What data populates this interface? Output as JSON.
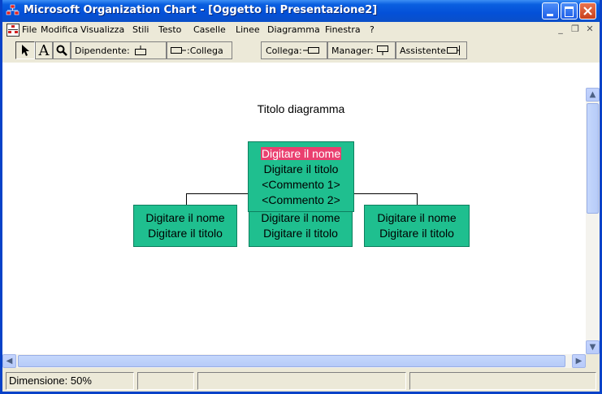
{
  "window": {
    "title": "Microsoft Organization Chart - [Oggetto in Presentazione2]",
    "accent_color": "#0a5fe0"
  },
  "menubar": {
    "items": [
      "File",
      "Modifica",
      "Visualizza",
      "Stili",
      "Testo",
      "Caselle",
      "Linee",
      "Diagramma",
      "Finestra",
      "?"
    ]
  },
  "toolbar": {
    "pointer_icon": "arrow-pointer-icon",
    "text_tool_label": "A",
    "zoom_icon": "magnifier-icon",
    "dipendente_label": "Dipendente:",
    "collega_left_label": ":Collega",
    "collega_right_label": "Collega:",
    "manager_label": "Manager:",
    "assistente_label": "Assistente"
  },
  "chart": {
    "title": "Titolo diagramma",
    "box_color": "#1fbf8f",
    "selected_text_color": "#ea3f6f",
    "manager": {
      "name": "Digitare il nome",
      "title": "Digitare il titolo",
      "comment1": "<Commento 1>",
      "comment2": "<Commento 2>"
    },
    "subordinates": [
      {
        "name": "Digitare il nome",
        "title": "Digitare il titolo"
      },
      {
        "name": "Digitare il nome",
        "title": "Digitare il titolo"
      },
      {
        "name": "Digitare il nome",
        "title": "Digitare il titolo"
      }
    ]
  },
  "statusbar": {
    "zoom_text": "Dimensione: 50%"
  }
}
